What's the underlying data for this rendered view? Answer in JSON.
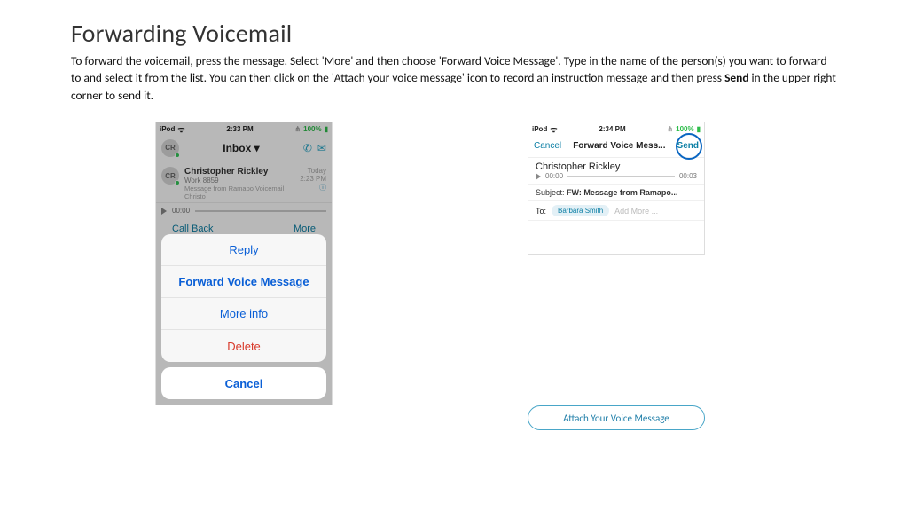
{
  "title": "Forwarding Voicemail",
  "body_prefix": "To forward the voicemail, press the message.  Select 'More' and then choose 'Forward Voice Message'.  Type in the name of the person(s) you want to forward to and select it from the list.  You can then click on the 'Attach your voice message' icon to record an instruction message and then press ",
  "body_send": "Send",
  "body_suffix": " in the upper right corner to send it.",
  "p1": {
    "status": {
      "device": "iPod",
      "time": "2:33 PM",
      "battery": "100%"
    },
    "avatar": "CR",
    "inbox": "Inbox ▾",
    "msg": {
      "name": "Christopher Rickley",
      "line2": "Work  8859",
      "line3": "Message from Ramapo Voicemail Christo",
      "day": "Today",
      "time": "2:23 PM"
    },
    "play": {
      "start": "00:00"
    },
    "callback": "Call Back",
    "more": "More",
    "sheet": {
      "reply": "Reply",
      "forward": "Forward Voice Message",
      "info": "More info",
      "delete": "Delete",
      "cancel": "Cancel"
    }
  },
  "p2": {
    "status": {
      "device": "iPod",
      "time": "2:34 PM",
      "battery": "100%"
    },
    "nav": {
      "cancel": "Cancel",
      "title": "Forward Voice Mess...",
      "send": "Send"
    },
    "sender": "Christopher Rickley",
    "play": {
      "start": "00:00",
      "end": "00:03"
    },
    "subject_label": "Subject:",
    "subject_value": "FW: Message from Ramapo...",
    "to_label": "To:",
    "to_pill": "Barbara Smith",
    "to_placeholder": "Add More ..."
  },
  "attach_label": "Attach Your Voice Message"
}
